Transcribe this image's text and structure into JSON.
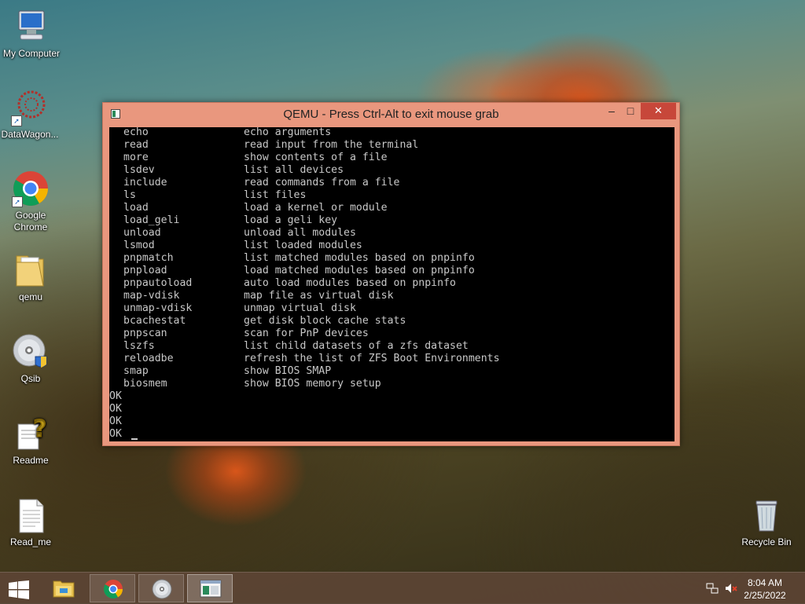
{
  "desktop": {
    "icons": [
      {
        "label": "My Computer"
      },
      {
        "label": "DataWagon..."
      },
      {
        "label": "Google Chrome"
      },
      {
        "label": "qemu"
      },
      {
        "label": "Qsib"
      },
      {
        "label": "Readme"
      },
      {
        "label": "Read_me"
      },
      {
        "label": "Recycle Bin"
      }
    ]
  },
  "window": {
    "title": "QEMU - Press Ctrl-Alt to exit mouse grab",
    "minimize_glyph": "–",
    "maximize_glyph": "□",
    "close_glyph": "✕"
  },
  "terminal": {
    "commands": [
      {
        "cmd": "echo",
        "desc": "echo arguments"
      },
      {
        "cmd": "read",
        "desc": "read input from the terminal"
      },
      {
        "cmd": "more",
        "desc": "show contents of a file"
      },
      {
        "cmd": "lsdev",
        "desc": "list all devices"
      },
      {
        "cmd": "include",
        "desc": "read commands from a file"
      },
      {
        "cmd": "ls",
        "desc": "list files"
      },
      {
        "cmd": "load",
        "desc": "load a kernel or module"
      },
      {
        "cmd": "load_geli",
        "desc": "load a geli key"
      },
      {
        "cmd": "unload",
        "desc": "unload all modules"
      },
      {
        "cmd": "lsmod",
        "desc": "list loaded modules"
      },
      {
        "cmd": "pnpmatch",
        "desc": "list matched modules based on pnpinfo"
      },
      {
        "cmd": "pnpload",
        "desc": "load matched modules based on pnpinfo"
      },
      {
        "cmd": "pnpautoload",
        "desc": "auto load modules based on pnpinfo"
      },
      {
        "cmd": "map-vdisk",
        "desc": "map file as virtual disk"
      },
      {
        "cmd": "unmap-vdisk",
        "desc": "unmap virtual disk"
      },
      {
        "cmd": "bcachestat",
        "desc": "get disk block cache stats"
      },
      {
        "cmd": "pnpscan",
        "desc": "scan for PnP devices"
      },
      {
        "cmd": "lszfs",
        "desc": "list child datasets of a zfs dataset"
      },
      {
        "cmd": "reloadbe",
        "desc": "refresh the list of ZFS Boot Environments"
      },
      {
        "cmd": "smap",
        "desc": "show BIOS SMAP"
      },
      {
        "cmd": "biosmem",
        "desc": "show BIOS memory setup"
      }
    ],
    "ok_lines": [
      "OK",
      "OK",
      "OK",
      "OK"
    ]
  },
  "taskbar": {
    "start_icon": "windows-logo-icon",
    "pinned": [
      {
        "name": "file-explorer-icon"
      },
      {
        "name": "chrome-icon"
      },
      {
        "name": "disc-icon"
      },
      {
        "name": "qemu-icon"
      }
    ],
    "clock_time": "8:04 AM",
    "clock_date": "2/25/2022"
  }
}
